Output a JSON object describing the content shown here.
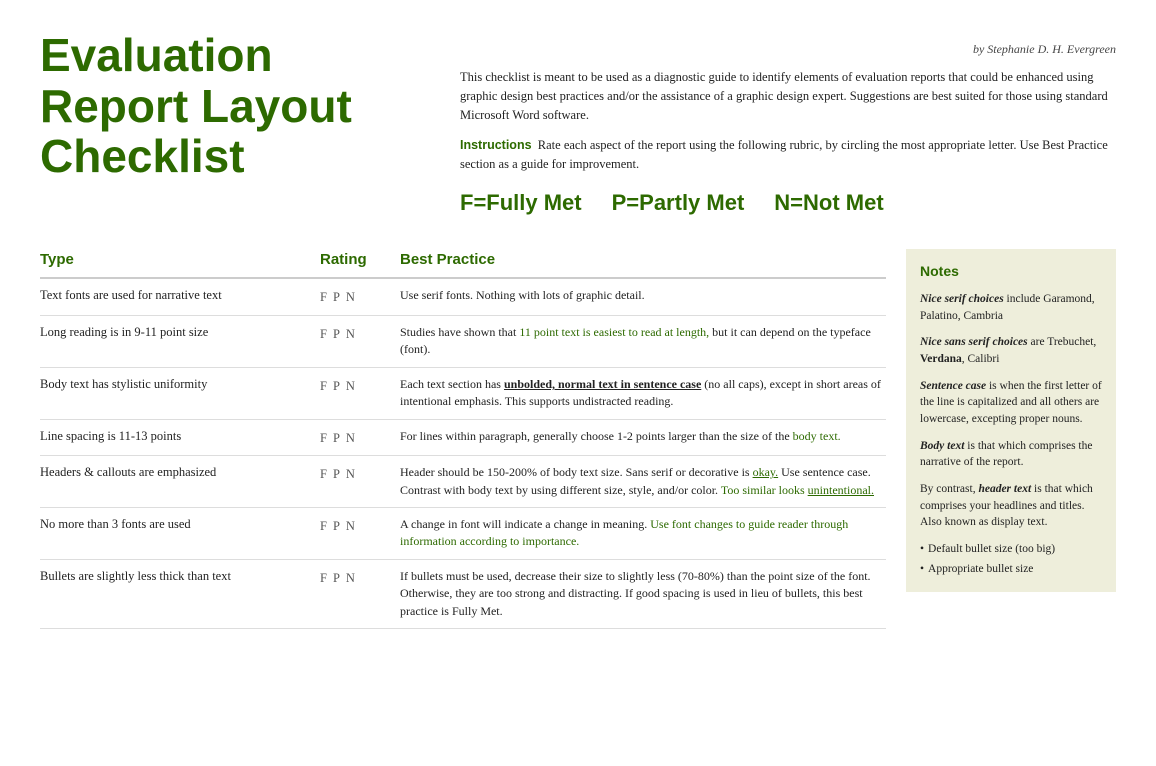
{
  "byline": "by Stephanie D. H. Evergreen",
  "title": "Evaluation Report Layout Checklist",
  "intro": "This checklist is meant to be used as a diagnostic guide to identify elements of evaluation reports that could be enhanced using graphic design best practices and/or the assistance of a graphic design expert. Suggestions are best suited for those using standard Microsoft Word software.",
  "instructions_label": "Instructions",
  "instructions_text": "Rate each aspect of the report using the following rubric, by circling the most appropriate letter. Use Best Practice section as a guide for improvement.",
  "rating_legend": [
    "F=Fully Met",
    "P=Partly Met",
    "N=Not Met"
  ],
  "columns": {
    "type": "Type",
    "rating": "Rating",
    "best_practice": "Best Practice"
  },
  "rows": [
    {
      "type": "Text fonts are used for narrative text",
      "rating": [
        "F",
        "P",
        "N"
      ],
      "best_practice": "Use serif fonts. Nothing with lots of graphic detail."
    },
    {
      "type": "Long reading is in 9-11 point size",
      "rating": [
        "F",
        "P",
        "N"
      ],
      "best_practice": "Studies have shown that 11 point text is easiest to read at length, but it can depend on the typeface (font)."
    },
    {
      "type": "Body text has stylistic uniformity",
      "rating": [
        "F",
        "P",
        "N"
      ],
      "best_practice": "Each text section has unbolded, normal text in sentence case (no all caps), except in short areas of intentional emphasis. This supports undistracted reading."
    },
    {
      "type": "Line spacing is 11-13 points",
      "rating": [
        "F",
        "P",
        "N"
      ],
      "best_practice": "For lines within paragraph, generally choose 1-2 points larger than the size of the body text."
    },
    {
      "type": "Headers & callouts are emphasized",
      "rating": [
        "F",
        "P",
        "N"
      ],
      "best_practice": "Header should be 150-200% of body text size. Sans serif or decorative is okay. Use sentence case. Contrast with body text by using different size, style, and/or color. Too similar looks unintentional."
    },
    {
      "type": "No more than 3 fonts are used",
      "rating": [
        "F",
        "P",
        "N"
      ],
      "best_practice": "A change in font will indicate a change in meaning. Use font changes to guide reader through information according to importance."
    },
    {
      "type": "Bullets are slightly less thick than text",
      "rating": [
        "F",
        "P",
        "N"
      ],
      "best_practice": "If bullets must be used, decrease their size to slightly less (70-80%) than the point size of the font. Otherwise, they are too strong and distracting. If good spacing is used in lieu of bullets, this best practice is Fully Met."
    }
  ],
  "notes": {
    "title": "Notes",
    "items": [
      {
        "italic_bold": "Nice serif choices",
        "text": " include Garamond, Palatino, Cambria"
      },
      {
        "italic_bold": "Nice sans serif choices",
        "text": " are Trebuchet, Verdana, Calibri"
      },
      {
        "italic_bold": "Sentence case",
        "text": " is when the first letter of the line is capitalized and all others are lowercase, excepting proper nouns."
      },
      {
        "italic_bold": "Body text",
        "text": " is that which comprises the narrative of the report."
      },
      {
        "text_before": "By contrast, ",
        "italic": "header text",
        "text_after": " is that which comprises your headlines and titles. Also known as display text."
      }
    ],
    "bullets": [
      "Default bullet size (too big)",
      "Appropriate bullet size"
    ]
  }
}
